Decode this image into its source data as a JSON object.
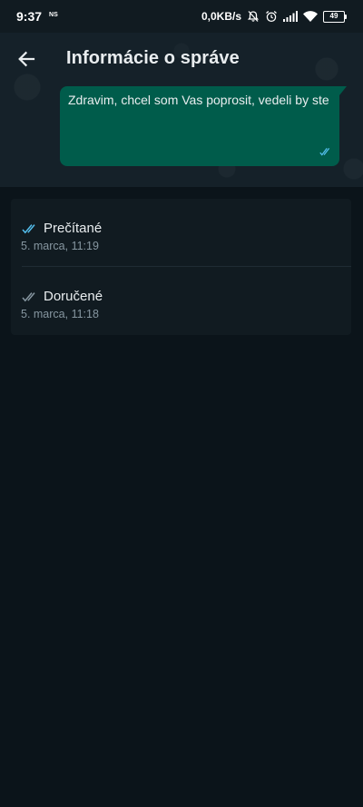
{
  "status_bar": {
    "time": "9:37",
    "notification_badge": "NS",
    "network_speed": "0,0KB/s",
    "battery_level": "49",
    "icons": [
      "mute-icon",
      "alarm-icon",
      "signal-icon",
      "wifi-icon",
      "battery-icon"
    ]
  },
  "header": {
    "title": "Informácie o správe",
    "back_icon": "arrow-left-icon"
  },
  "message": {
    "text": "Zdravim, chcel som Vas poprosit, vedeli by ste",
    "status_icon": "double-check-icon",
    "status_color": "#53bdeb"
  },
  "receipts": [
    {
      "label": "Prečítané",
      "time": "5. marca, 11:19",
      "icon": "double-check-blue-icon",
      "icon_color": "#53bdeb"
    },
    {
      "label": "Doručené",
      "time": "5. marca, 11:18",
      "icon": "double-check-gray-icon",
      "icon_color": "#8696a0"
    }
  ],
  "colors": {
    "background": "#0b141a",
    "header_bg": "#152129",
    "bubble": "#005c4b",
    "card": "#111b21",
    "secondary_text": "#8696a0"
  }
}
